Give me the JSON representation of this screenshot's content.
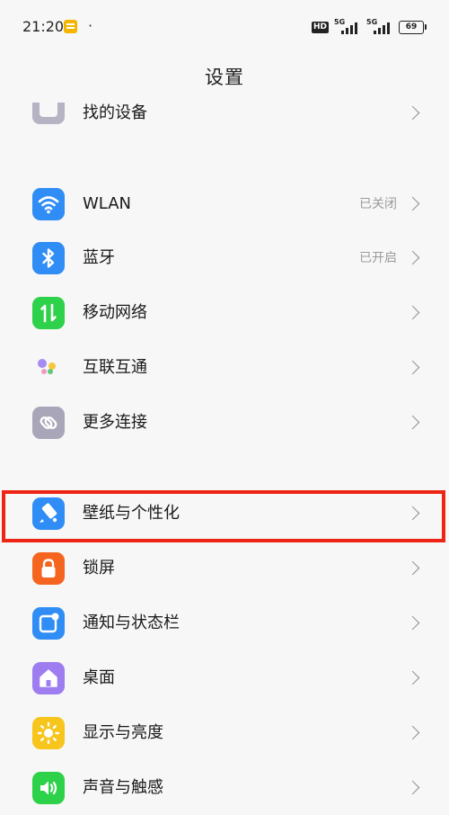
{
  "status_bar": {
    "time": "21:20",
    "dot": "·",
    "hd": "HD",
    "network_1": "5G",
    "network_2": "5G",
    "battery": "69"
  },
  "header": {
    "title": "设置"
  },
  "settings": {
    "find_device": {
      "label": "找的设备"
    },
    "wlan": {
      "label": "WLAN",
      "value": "已关闭"
    },
    "bluetooth": {
      "label": "蓝牙",
      "value": "已开启"
    },
    "mobile_network": {
      "label": "移动网络"
    },
    "interconnect": {
      "label": "互联互通"
    },
    "more_connections": {
      "label": "更多连接"
    },
    "wallpaper": {
      "label": "壁纸与个性化"
    },
    "lock_screen": {
      "label": "锁屏"
    },
    "notifications": {
      "label": "通知与状态栏"
    },
    "desktop": {
      "label": "桌面"
    },
    "display": {
      "label": "显示与亮度"
    },
    "sound": {
      "label": "声音与触感"
    }
  },
  "colors": {
    "wlan": "#2f8df5",
    "bluetooth": "#2f8df5",
    "mobile_network": "#2dd14a",
    "more_connections": "#a9a6b9",
    "wallpaper": "#2f8df5",
    "lock_screen": "#f5651f",
    "notifications": "#2f8df5",
    "desktop": "#9d7df0",
    "display": "#f7c51c",
    "sound": "#2dd14a",
    "highlight": "#ee2414"
  }
}
